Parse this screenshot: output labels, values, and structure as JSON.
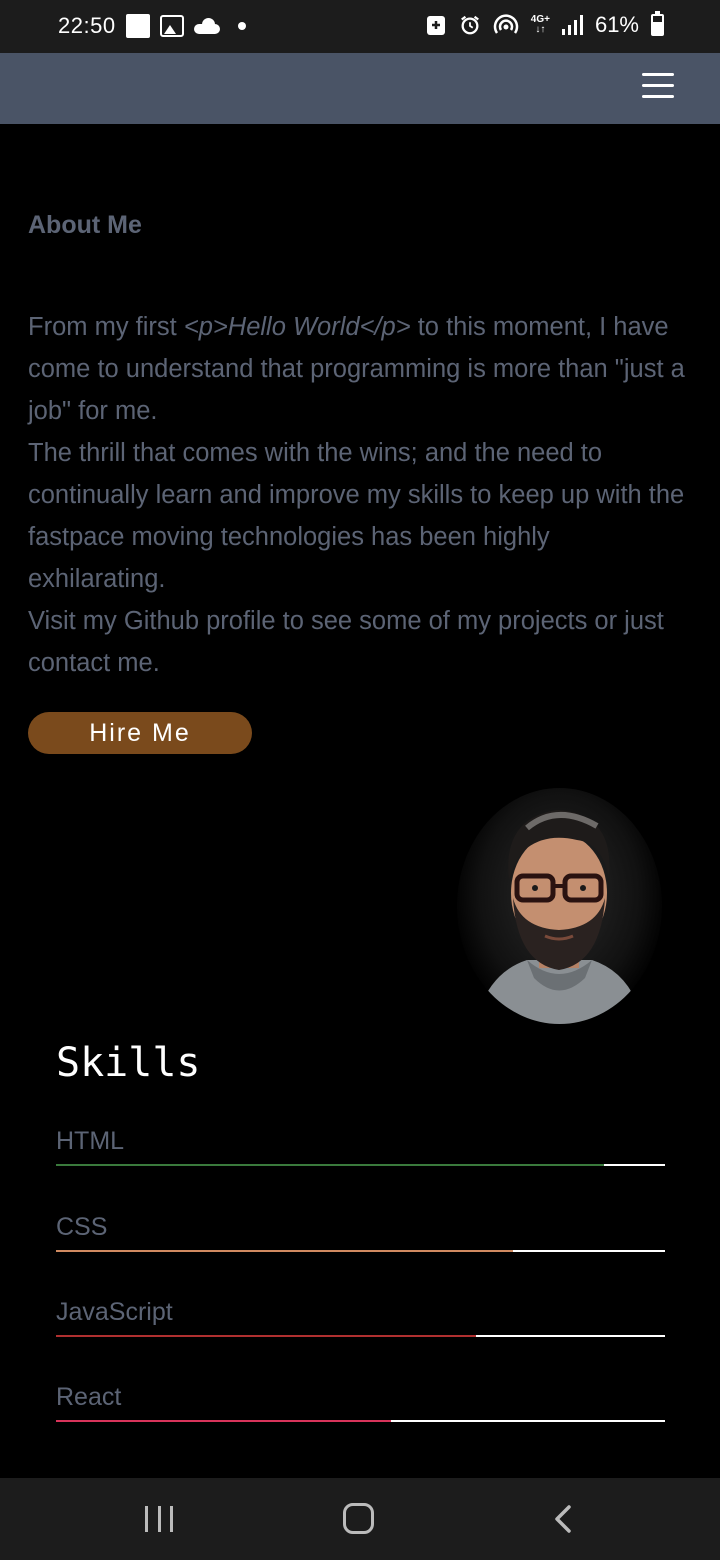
{
  "status_bar": {
    "time": "22:50",
    "network": "4G+",
    "battery": "61%",
    "battery_level": 0.61
  },
  "header": {
    "menu_icon": "hamburger-menu-icon"
  },
  "about": {
    "title": "About Me",
    "para1_before": "From my first ",
    "para1_code": "<p>Hello World</p>",
    "para1_after": " to this moment, I have come to understand that programming is more than \"just a job\" for me.",
    "para2": "The thrill that comes with the wins; and the need to continually learn and improve my skills to keep up with the fastpace moving technologies has been highly exhilarating.",
    "para3": "Visit my Github profile to see some of my projects or just contact me.",
    "hire_label": "Hire Me"
  },
  "skills": {
    "title": "Skills",
    "items": [
      {
        "label": "HTML",
        "level": 0.9,
        "color": "#3a7a3c"
      },
      {
        "label": "CSS",
        "level": 0.75,
        "color": "#d08a60"
      },
      {
        "label": "JavaScript",
        "level": 0.69,
        "color": "#b03030"
      },
      {
        "label": "React",
        "level": 0.55,
        "color": "#d8335a"
      }
    ]
  }
}
